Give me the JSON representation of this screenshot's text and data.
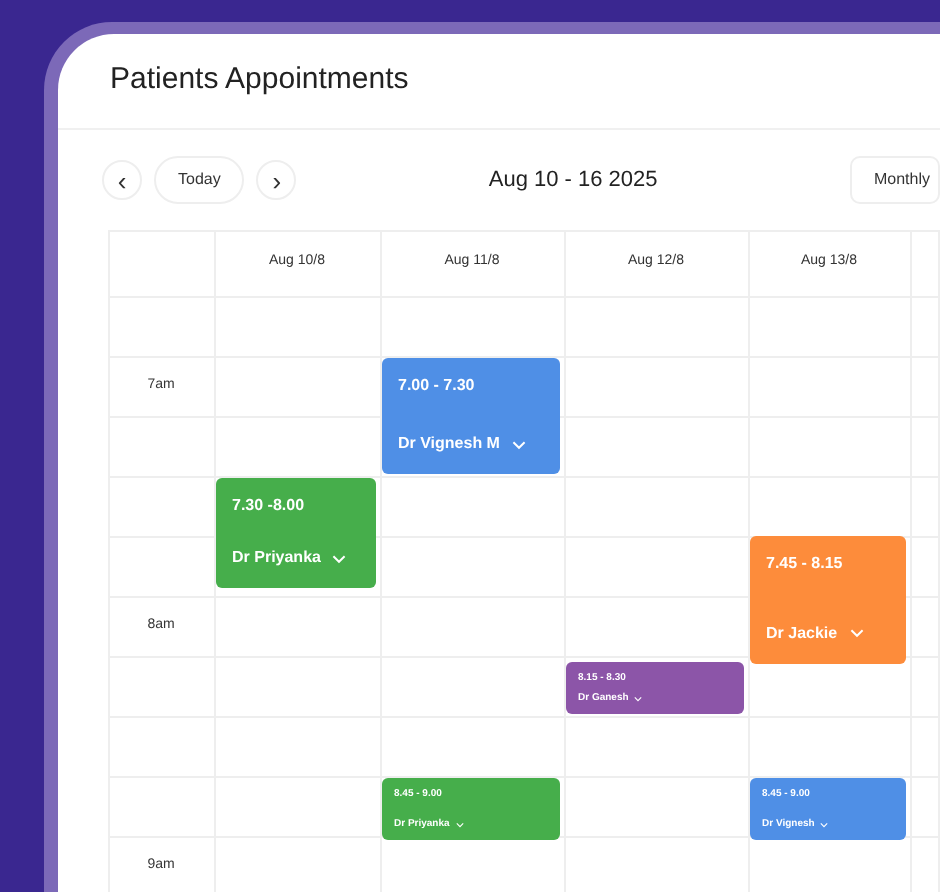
{
  "title": "Patients Appointments",
  "toolbar": {
    "prev": "‹",
    "today": "Today",
    "next": "›",
    "range": "Aug 10 - 16 2025",
    "view": "Monthly"
  },
  "days": [
    "Aug 10/8",
    "Aug 11/8",
    "Aug 12/8",
    "Aug 13/8"
  ],
  "times": [
    {
      "label": "7am"
    },
    {
      "label": "8am"
    },
    {
      "label": "9am"
    }
  ],
  "appointments": [
    {
      "time": "7.00 - 7.30",
      "doctor": "Dr Vignesh M",
      "color": "#4f8fe6"
    },
    {
      "time": "7.30 -8.00",
      "doctor": "Dr Priyanka",
      "color": "#46ae4b"
    },
    {
      "time": "7.45 - 8.15",
      "doctor": "Dr Jackie",
      "color": "#fd8c3b"
    },
    {
      "time": "8.15 - 8.30",
      "doctor": "Dr Ganesh",
      "color": "#8c55a8"
    },
    {
      "time": "8.45 - 9.00",
      "doctor": "Dr Priyanka",
      "color": "#46ae4b"
    },
    {
      "time": "8.45 - 9.00",
      "doctor": "Dr Vignesh",
      "color": "#4f8fe6"
    }
  ]
}
